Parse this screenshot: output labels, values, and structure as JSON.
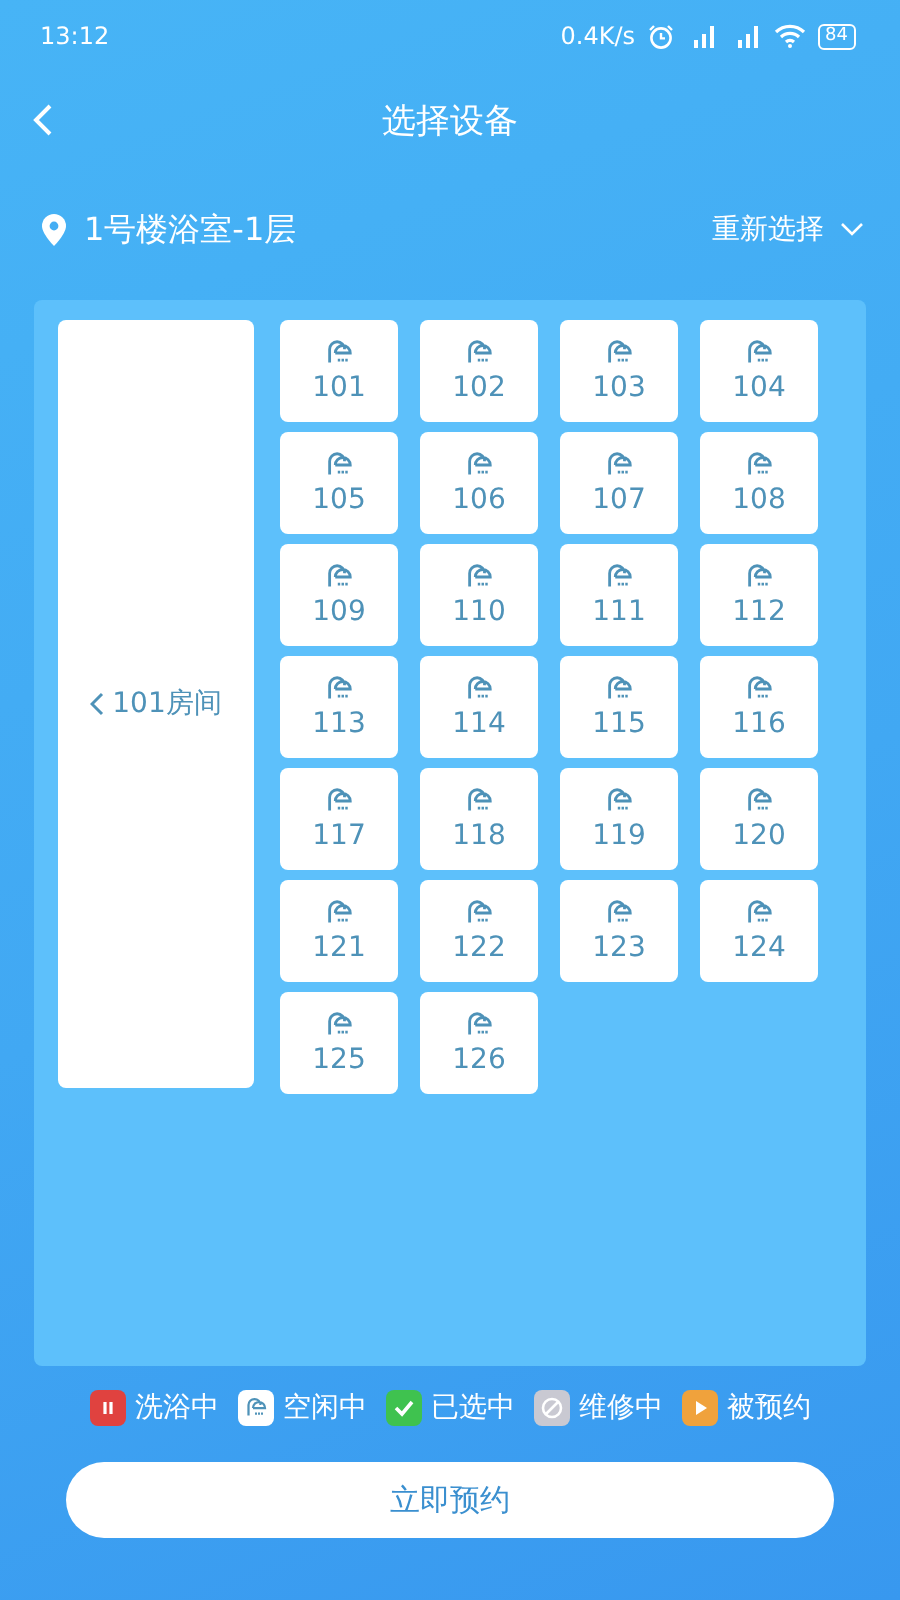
{
  "status_bar": {
    "time": "13:12",
    "speed": "0.4K/s",
    "battery": "84"
  },
  "header": {
    "title": "选择设备"
  },
  "location": {
    "name": "1号楼浴室-1层",
    "action": "重新选择"
  },
  "room": {
    "label": "101房间"
  },
  "devices": [
    {
      "number": "101",
      "kind": "idle"
    },
    {
      "number": "102",
      "kind": "idle"
    },
    {
      "number": "103",
      "kind": "idle"
    },
    {
      "number": "104",
      "kind": "idle"
    },
    {
      "number": "105",
      "kind": "idle"
    },
    {
      "number": "106",
      "kind": "idle"
    },
    {
      "number": "107",
      "kind": "idle"
    },
    {
      "number": "108",
      "kind": "idle"
    },
    {
      "number": "109",
      "kind": "idle"
    },
    {
      "number": "110",
      "kind": "idle"
    },
    {
      "number": "111",
      "kind": "idle"
    },
    {
      "number": "112",
      "kind": "idle"
    },
    {
      "number": "113",
      "kind": "idle"
    },
    {
      "number": "114",
      "kind": "idle"
    },
    {
      "number": "115",
      "kind": "idle"
    },
    {
      "number": "116",
      "kind": "idle"
    },
    {
      "number": "117",
      "kind": "idle"
    },
    {
      "number": "118",
      "kind": "idle"
    },
    {
      "number": "119",
      "kind": "idle"
    },
    {
      "number": "120",
      "kind": "idle"
    },
    {
      "number": "121",
      "kind": "idle"
    },
    {
      "number": "122",
      "kind": "idle"
    },
    {
      "number": "123",
      "kind": "idle"
    },
    {
      "number": "124",
      "kind": "idle"
    },
    {
      "number": "125",
      "kind": "idle"
    },
    {
      "number": "126",
      "kind": "idle"
    }
  ],
  "legend": [
    {
      "kind": "busy",
      "label": "洗浴中",
      "color": "#e0423f"
    },
    {
      "kind": "idle",
      "label": "空闲中",
      "color": "#ffffff"
    },
    {
      "kind": "selected",
      "label": "已选中",
      "color": "#3fc24f"
    },
    {
      "kind": "repair",
      "label": "维修中",
      "color": "#c9c9d2"
    },
    {
      "kind": "reserved",
      "label": "被预约",
      "color": "#f0a23c"
    }
  ],
  "button": {
    "label": "立即预约"
  }
}
